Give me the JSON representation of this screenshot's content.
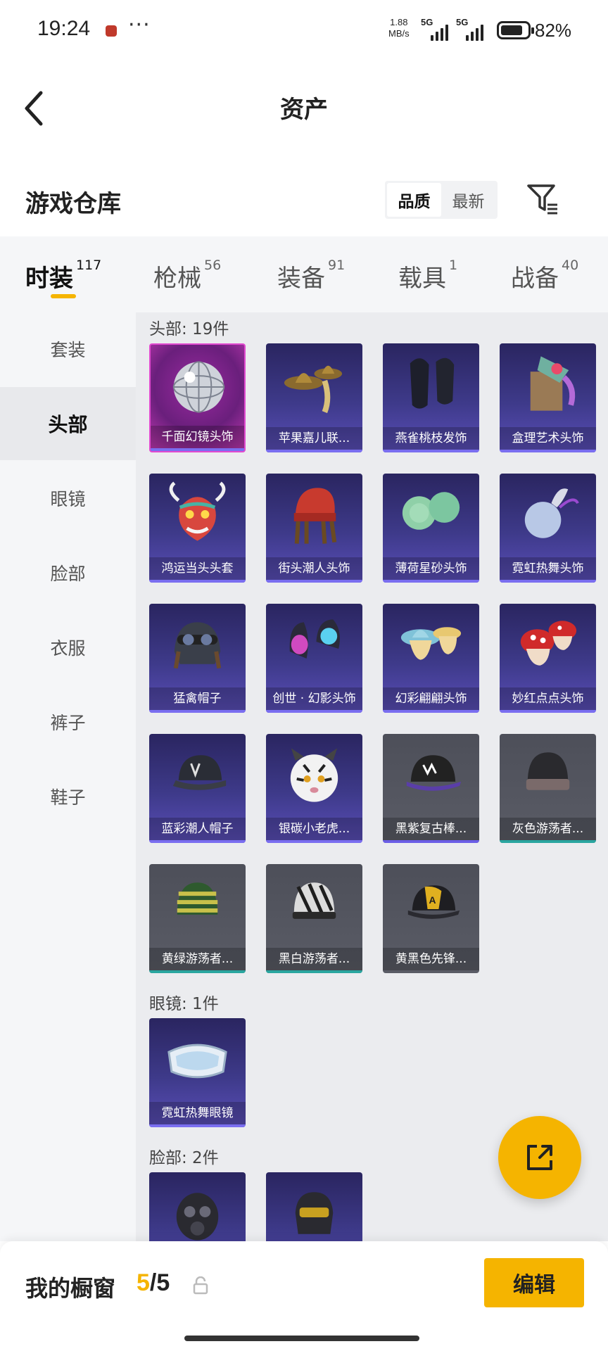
{
  "status_bar": {
    "time": "19:24",
    "dots": "···",
    "speed_value": "1.88",
    "speed_unit": "MB/s",
    "sim1_label": "5G",
    "sim2_label": "5G",
    "battery": "82%",
    "battery_level": 0.82
  },
  "header": {
    "back_icon": "chevron-left-icon",
    "title": "资产"
  },
  "section": {
    "title": "游戏仓库",
    "sort_options": [
      "品质",
      "最新"
    ],
    "sort_selected": "品质",
    "filter_icon": "filter-icon"
  },
  "tabs": [
    {
      "label": "时装",
      "count": "117",
      "active": true
    },
    {
      "label": "枪械",
      "count": "56",
      "active": false
    },
    {
      "label": "装备",
      "count": "91",
      "active": false
    },
    {
      "label": "载具",
      "count": "1",
      "active": false
    },
    {
      "label": "战备",
      "count": "40",
      "active": false
    }
  ],
  "sidebar": {
    "items": [
      {
        "label": "套装",
        "active": false
      },
      {
        "label": "头部",
        "active": true
      },
      {
        "label": "眼镜",
        "active": false
      },
      {
        "label": "脸部",
        "active": false
      },
      {
        "label": "衣服",
        "active": false
      },
      {
        "label": "裤子",
        "active": false
      },
      {
        "label": "鞋子",
        "active": false
      }
    ]
  },
  "groups": [
    {
      "label": "头部: 19件",
      "items": [
        {
          "name": "千面幻镜头饰",
          "rarity": "pink",
          "icon": "disco-ball-icon"
        },
        {
          "name": "苹果嘉儿联...",
          "rarity": "purple",
          "icon": "cowboy-hat-icon"
        },
        {
          "name": "燕雀桃枝发饰",
          "rarity": "purple",
          "icon": "hair-icon"
        },
        {
          "name": "盒理艺术头饰",
          "rarity": "purple",
          "icon": "box-head-icon"
        },
        {
          "name": "鸿运当头头套",
          "rarity": "purple",
          "icon": "dragon-mask-icon"
        },
        {
          "name": "街头潮人头饰",
          "rarity": "purple",
          "icon": "beanie-dreads-icon"
        },
        {
          "name": "薄荷星砂头饰",
          "rarity": "purple",
          "icon": "mint-hair-icon"
        },
        {
          "name": "霓虹热舞头饰",
          "rarity": "purple",
          "icon": "bunny-hair-icon"
        },
        {
          "name": "猛禽帽子",
          "rarity": "purple",
          "icon": "aviator-cap-icon"
        },
        {
          "name": "创世 · 幻影头饰",
          "rarity": "purple",
          "icon": "helmet-icon"
        },
        {
          "name": "幻彩翩翩头饰",
          "rarity": "purple",
          "icon": "sunhat-icon"
        },
        {
          "name": "妙红点点头饰",
          "rarity": "purple",
          "icon": "mushroom-hat-icon"
        },
        {
          "name": "蓝彩潮人帽子",
          "rarity": "purple",
          "icon": "trucker-cap-icon"
        },
        {
          "name": "银碳小老虎...",
          "rarity": "purple",
          "icon": "tiger-head-icon"
        },
        {
          "name": "黑紫复古棒...",
          "rarity": "gray-purple",
          "icon": "baseball-cap-icon"
        },
        {
          "name": "灰色游荡者...",
          "rarity": "gray-teal",
          "icon": "knit-cap-icon"
        },
        {
          "name": "黄绿游荡者...",
          "rarity": "gray-teal",
          "icon": "striped-beanie-icon"
        },
        {
          "name": "黑白游荡者...",
          "rarity": "gray-teal",
          "icon": "zebra-beanie-icon"
        },
        {
          "name": "黄黑色先锋...",
          "rarity": "gray",
          "icon": "yellow-cap-icon"
        }
      ]
    },
    {
      "label": "眼镜: 1件",
      "items": [
        {
          "name": "霓虹热舞眼镜",
          "rarity": "purple",
          "icon": "goggles-icon"
        }
      ]
    },
    {
      "label": "脸部: 2件",
      "items": [
        {
          "name": "",
          "rarity": "purple",
          "icon": "gas-mask-icon"
        },
        {
          "name": "",
          "rarity": "purple",
          "icon": "face-mask-icon"
        }
      ]
    }
  ],
  "fab": {
    "icon": "share-external-icon"
  },
  "bottom_bar": {
    "label": "我的橱窗",
    "count_current": "5",
    "count_sep": "/",
    "count_max": "5",
    "lock_icon": "lock-icon",
    "edit_label": "编辑"
  }
}
